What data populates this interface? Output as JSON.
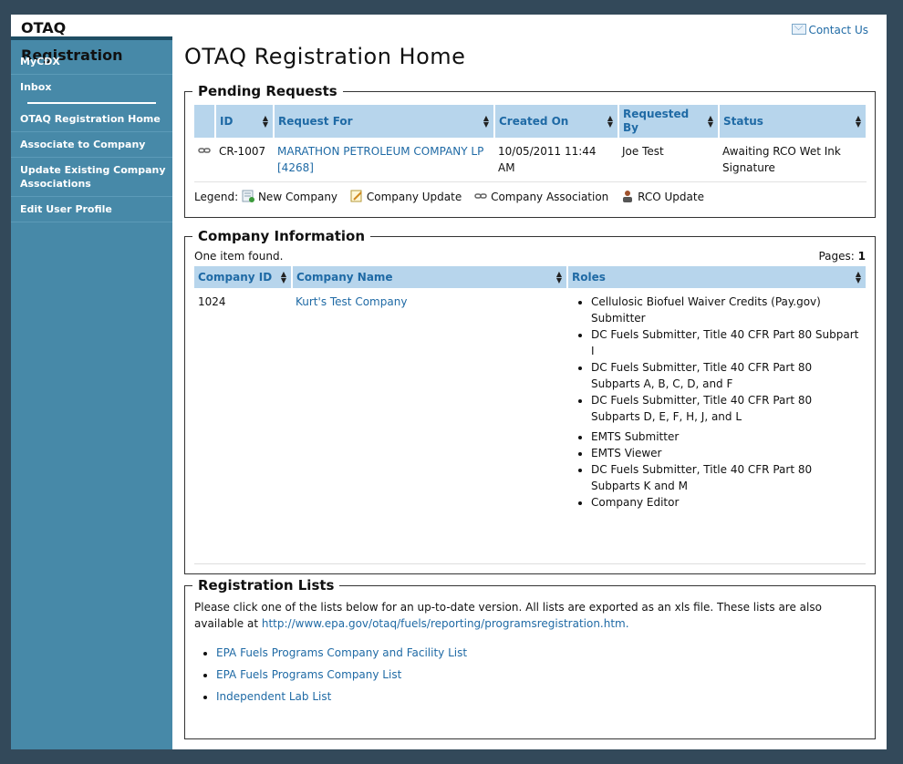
{
  "app": {
    "title": "OTAQ Registration"
  },
  "sidebar": {
    "items": [
      {
        "label": "MyCDX"
      },
      {
        "label": "Inbox"
      },
      {
        "label": "OTAQ Registration Home"
      },
      {
        "label": "Associate to Company"
      },
      {
        "label": "Update Existing Company Associations"
      },
      {
        "label": "Edit User Profile"
      }
    ]
  },
  "header": {
    "contact": "Contact Us",
    "page_title": "OTAQ Registration Home"
  },
  "pending": {
    "legend": "Pending Requests",
    "columns": [
      "ID",
      "Request For",
      "Created On",
      "Requested By",
      "Status"
    ],
    "rows": [
      {
        "id": "CR-1007",
        "request_for": "MARATHON PETROLEUM COMPANY LP [4268]",
        "created_on": "10/05/2011 11:44 AM",
        "requested_by": "Joe Test",
        "status": "Awaiting RCO Wet Ink Signature"
      }
    ],
    "legend_label": "Legend:",
    "legend_items": [
      "New Company",
      "Company Update",
      "Company Association",
      "RCO Update"
    ]
  },
  "company": {
    "legend": "Company Information",
    "found": "One item found.",
    "pages_label": "Pages:",
    "pages_value": "1",
    "columns": [
      "Company ID",
      "Company Name",
      "Roles"
    ],
    "rows": [
      {
        "id": "1024",
        "name": "Kurt's Test Company",
        "roles": [
          "Cellulosic Biofuel Waiver Credits (Pay.gov) Submitter",
          "DC Fuels Submitter, Title 40 CFR Part 80 Subpart I",
          "DC Fuels Submitter, Title 40 CFR Part 80 Subparts A, B, C, D, and F",
          "DC Fuels Submitter, Title 40 CFR Part 80 Subparts D, E, F, H, J, and L",
          "EMTS Submitter",
          "EMTS Viewer",
          "DC Fuels Submitter, Title 40 CFR Part 80 Subparts K and M",
          "Company Editor"
        ]
      }
    ]
  },
  "lists": {
    "legend": "Registration Lists",
    "intro": "Please click one of the lists below for an up-to-date version. All lists are exported as an xls file. These lists are also available at",
    "url": "http://www.epa.gov/otaq/fuels/reporting/programsregistration.htm.",
    "items": [
      "EPA Fuels Programs Company and Facility List",
      "EPA Fuels Programs Company List",
      "Independent Lab List"
    ]
  }
}
